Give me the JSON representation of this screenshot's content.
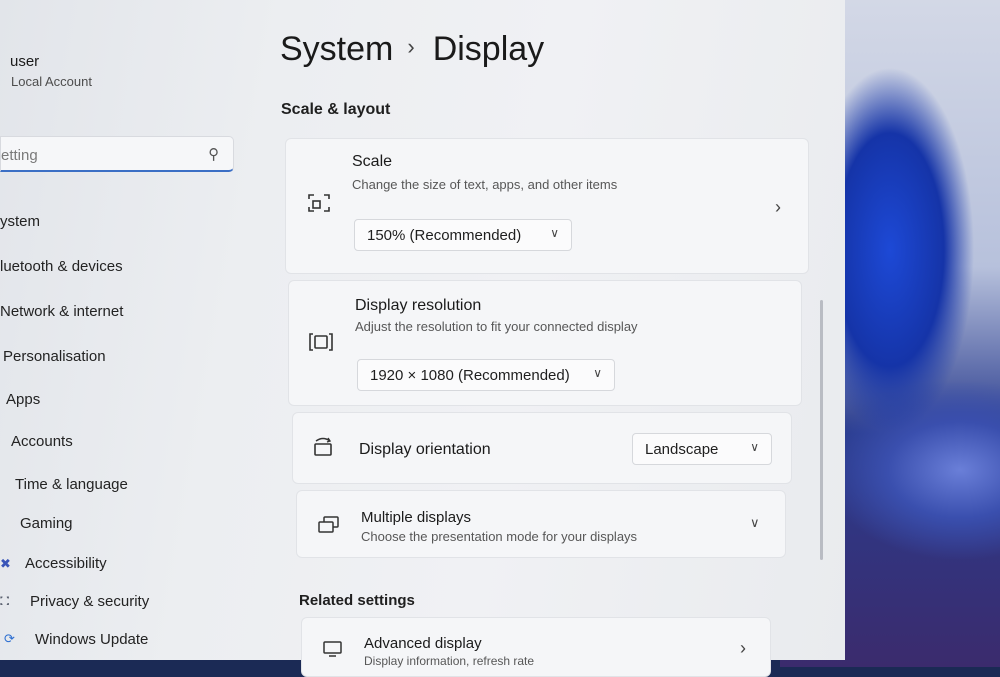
{
  "user": {
    "name": "user",
    "account_type": "Local Account"
  },
  "search": {
    "value": "etting"
  },
  "sidebar": {
    "items": [
      {
        "label": "ystem",
        "icon": "system-icon"
      },
      {
        "label": "luetooth & devices",
        "icon": "bluetooth-icon"
      },
      {
        "label": "Network & internet",
        "icon": "network-icon"
      },
      {
        "label": "Personalisation",
        "icon": "personalisation-icon"
      },
      {
        "label": "Apps",
        "icon": "apps-icon"
      },
      {
        "label": "Accounts",
        "icon": "accounts-icon"
      },
      {
        "label": "Time & language",
        "icon": "time-language-icon"
      },
      {
        "label": "Gaming",
        "icon": "gaming-icon"
      },
      {
        "label": "Accessibility",
        "icon": "accessibility-icon"
      },
      {
        "label": "Privacy & security",
        "icon": "shield-icon"
      },
      {
        "label": "Windows Update",
        "icon": "windows-update-icon"
      }
    ]
  },
  "header": {
    "parent": "System",
    "separator": "›",
    "current": "Display"
  },
  "sections": {
    "scale_layout": "Scale & layout",
    "related": "Related settings"
  },
  "scale": {
    "title": "Scale",
    "description": "Change the size of text, apps, and other items",
    "value": "150% (Recommended)"
  },
  "resolution": {
    "title": "Display resolution",
    "description": "Adjust the resolution to fit your connected display",
    "value": "1920 × 1080 (Recommended)"
  },
  "orientation": {
    "title": "Display orientation",
    "value": "Landscape"
  },
  "multiple": {
    "title": "Multiple displays",
    "description": "Choose the presentation mode for your displays"
  },
  "advanced": {
    "title": "Advanced display",
    "description": "Display information, refresh rate"
  },
  "colors": {
    "accent": "#3b6fc5",
    "text": "#1b1b1b",
    "subtext": "#575757"
  }
}
